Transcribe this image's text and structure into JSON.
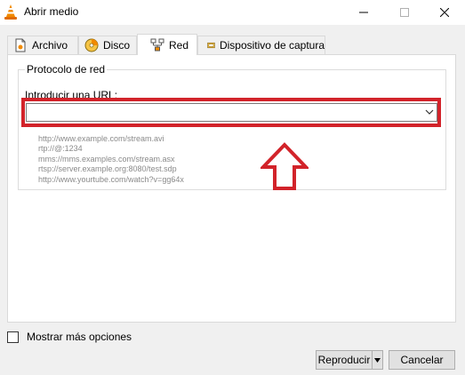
{
  "window": {
    "title": "Abrir medio",
    "app_icon": "vlc-cone-icon",
    "controls": [
      "minimize-icon",
      "maximize-icon",
      "close-icon"
    ]
  },
  "tabs": [
    {
      "label": "Archivo",
      "icon": "file-icon",
      "active": false
    },
    {
      "label": "Disco",
      "icon": "disc-icon",
      "active": false
    },
    {
      "label": "Red",
      "icon": "network-icon",
      "active": true
    },
    {
      "label": "Dispositivo de captura",
      "icon": "capture-device-icon",
      "active": false
    }
  ],
  "network": {
    "group_title": "Protocolo de red",
    "url_label": "Introducir una URL:",
    "url_value": "",
    "examples": [
      "http://www.example.com/stream.avi",
      "rtp://@:1234",
      "mms://mms.examples.com/stream.asx",
      "rtsp://server.example.org:8080/test.sdp",
      "http://www.yourtube.com/watch?v=gg64x"
    ],
    "annotation_color": "#d2232a"
  },
  "footer": {
    "more_options_label": "Mostrar más opciones",
    "more_options_checked": false,
    "play_label": "Reproducir",
    "cancel_label": "Cancelar"
  }
}
